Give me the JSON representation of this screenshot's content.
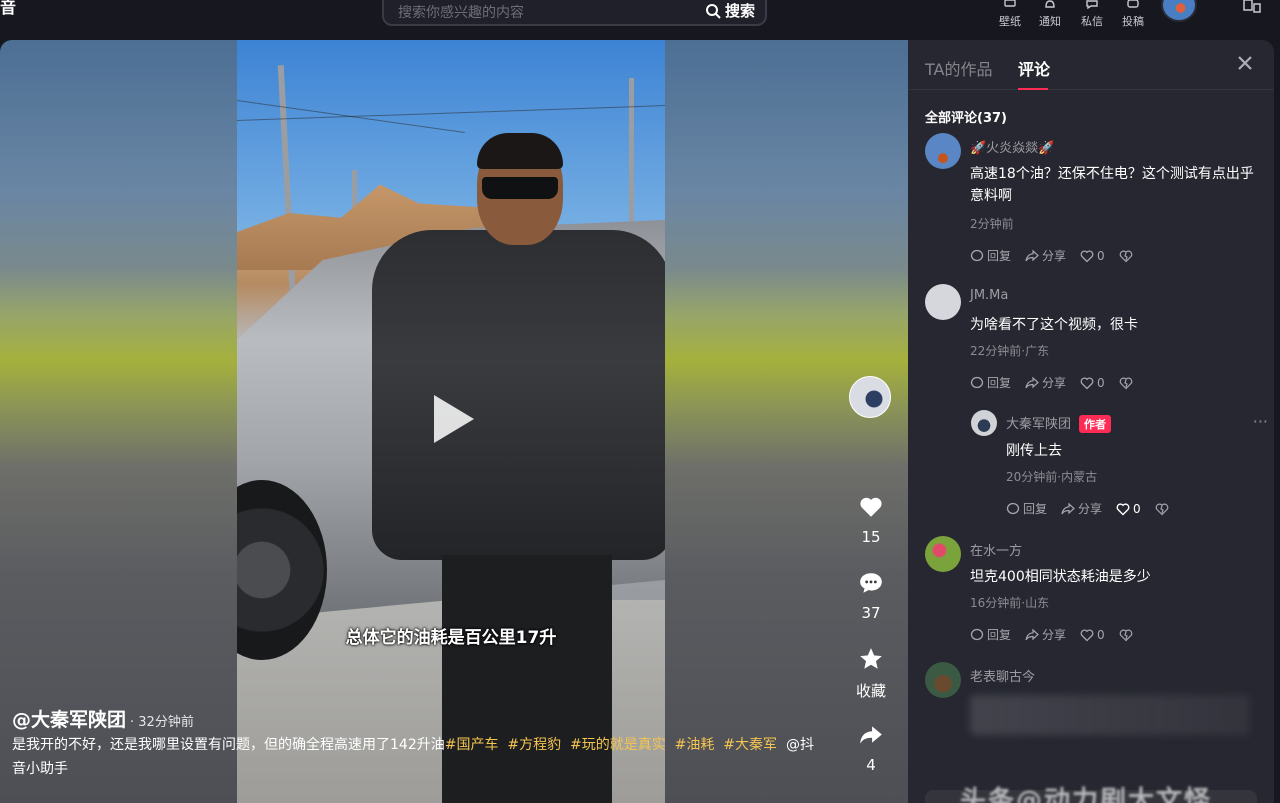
{
  "topbar": {
    "logo_fragment": "音",
    "search_placeholder": "搜索你感兴趣的内容",
    "search_button": "搜索",
    "tools": [
      {
        "label": "壁纸",
        "icon": "wallpaper-icon"
      },
      {
        "label": "通知",
        "icon": "bell-icon"
      },
      {
        "label": "私信",
        "icon": "message-icon"
      },
      {
        "label": "投稿",
        "icon": "upload-icon"
      }
    ]
  },
  "video": {
    "subtitle": "总体它的油耗是百公里17升",
    "likes": "15",
    "comments": "37",
    "favorite_label": "收藏",
    "shares": "4",
    "author": "@大秦军陕团",
    "posted": "· 32分钟前",
    "desc_text": "是我开的不好，还是我哪里设置有问题，但的确全程高速用了142升油",
    "tags": [
      "#国产车",
      "#方程豹",
      "#玩的就是真实",
      "#油耗",
      "#大秦军"
    ],
    "mention": "@抖音小助手"
  },
  "comments_panel": {
    "tab_works": "TA的作品",
    "tab_comments": "评论",
    "all_label": "全部评论(37)",
    "reply_label": "回复",
    "share_label": "分享",
    "author_badge": "作者",
    "items": [
      {
        "name": "🚀火炎焱燚🚀",
        "text": "高速18个油？还保不住电？这个测试有点出乎意料啊",
        "meta": "2分钟前",
        "likes": "0"
      },
      {
        "name": "JM.Ma",
        "text": "为啥看不了这个视频，很卡",
        "meta": "22分钟前·广东",
        "likes": "0"
      },
      {
        "name": "大秦军陕团",
        "text": "刚传上去",
        "meta": "20分钟前·内蒙古",
        "likes": "0"
      },
      {
        "name": "在水一方",
        "text": "坦克400相同状态耗油是多少",
        "meta": "16分钟前·山东",
        "likes": "0"
      },
      {
        "name": "老表聊古今"
      }
    ],
    "watermark": "头条@动力剧大文怪"
  }
}
